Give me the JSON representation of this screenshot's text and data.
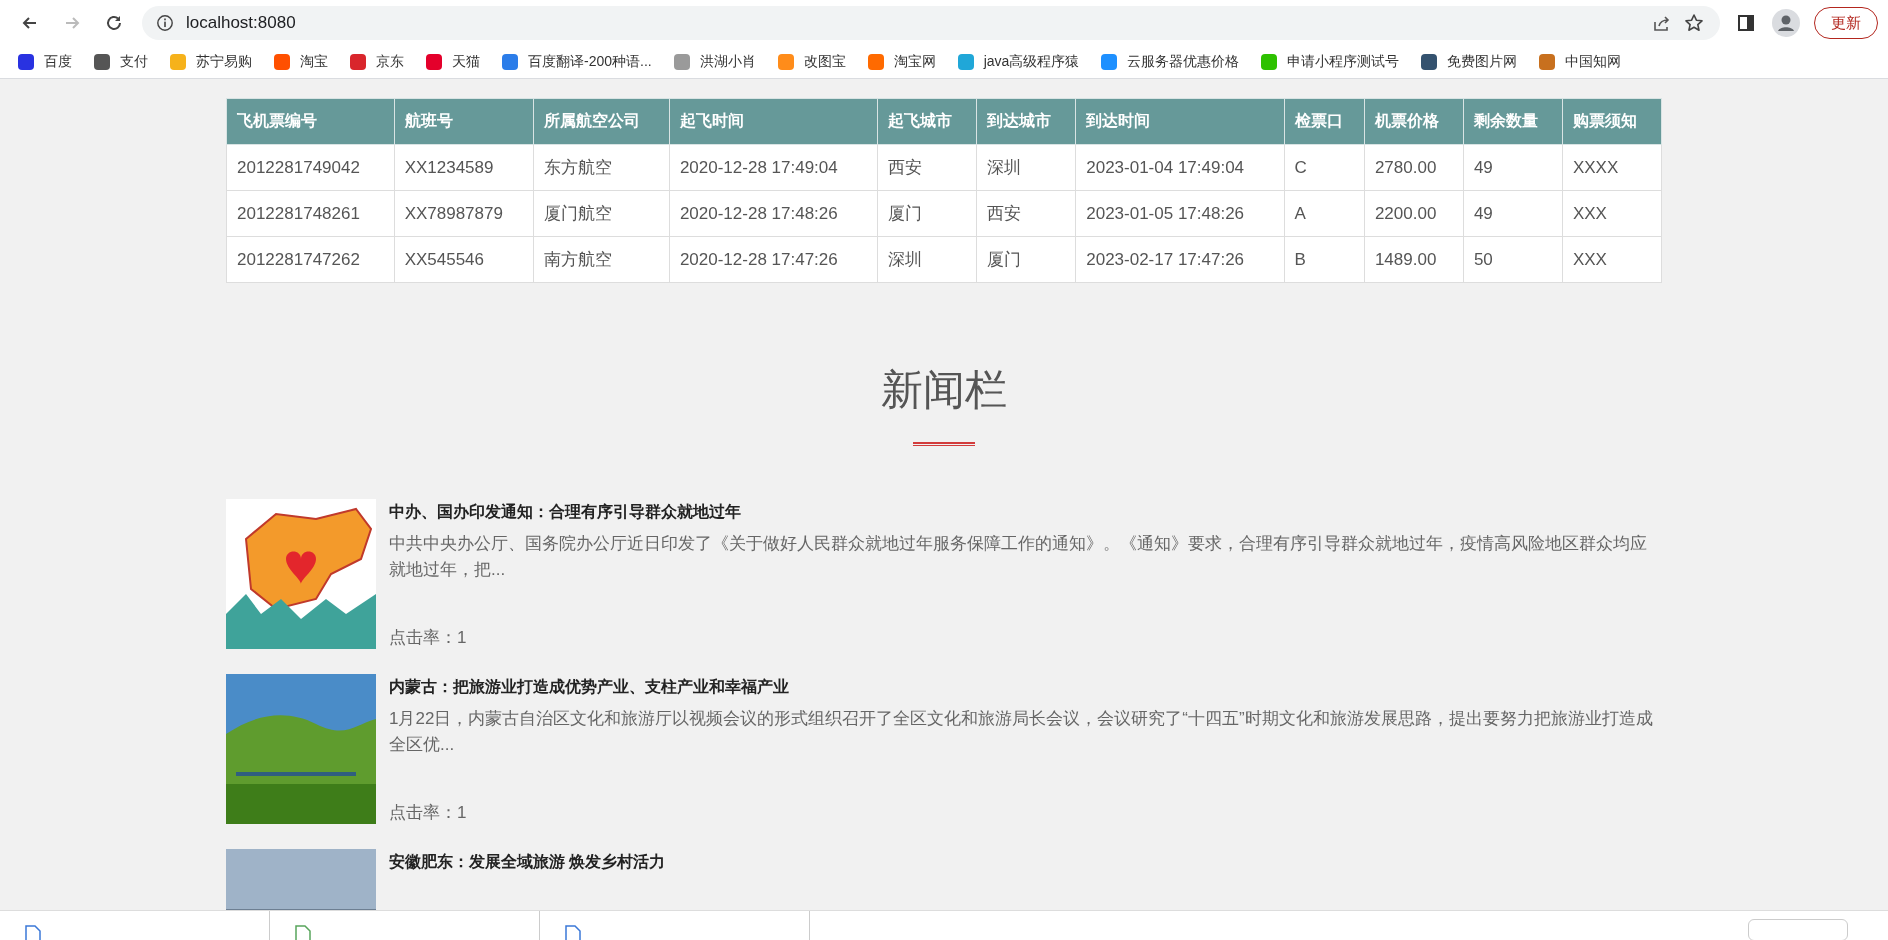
{
  "browser": {
    "back_disabled": false,
    "forward_disabled": true,
    "url": "localhost:8080",
    "update_button": "更新"
  },
  "bookmarks": [
    {
      "label": "百度",
      "color": "#2932e1"
    },
    {
      "label": "支付",
      "color": "#555555"
    },
    {
      "label": "苏宁易购",
      "color": "#f6b21b"
    },
    {
      "label": "淘宝",
      "color": "#ff5000"
    },
    {
      "label": "京东",
      "color": "#d9262c"
    },
    {
      "label": "天猫",
      "color": "#e4002b"
    },
    {
      "label": "百度翻译-200种语...",
      "color": "#2b7de9"
    },
    {
      "label": "洪湖小肖",
      "color": "#9a9a9a"
    },
    {
      "label": "改图宝",
      "color": "#ff8c1a"
    },
    {
      "label": "淘宝网",
      "color": "#ff6a00"
    },
    {
      "label": "java高级程序猿",
      "color": "#20a7d8"
    },
    {
      "label": "云服务器优惠价格",
      "color": "#1e90ff"
    },
    {
      "label": "申请小程序测试号",
      "color": "#2dc100"
    },
    {
      "label": "免费图片网",
      "color": "#34526f"
    },
    {
      "label": "中国知网",
      "color": "#c8701e"
    }
  ],
  "table": {
    "columns": [
      "飞机票编号",
      "航班号",
      "所属航空公司",
      "起飞时间",
      "起飞城市",
      "到达城市",
      "到达时间",
      "检票口",
      "机票价格",
      "剩余数量",
      "购票须知"
    ],
    "rows": [
      [
        "2012281749042",
        "XX1234589",
        "东方航空",
        "2020-12-28 17:49:04",
        "西安",
        "深圳",
        "2023-01-04 17:49:04",
        "C",
        "2780.00",
        "49",
        "XXXX"
      ],
      [
        "2012281748261",
        "XX78987879",
        "厦门航空",
        "2020-12-28 17:48:26",
        "厦门",
        "西安",
        "2023-01-05 17:48:26",
        "A",
        "2200.00",
        "49",
        "XXX"
      ],
      [
        "2012281747262",
        "XX545546",
        "南方航空",
        "2020-12-28 17:47:26",
        "深圳",
        "厦门",
        "2023-02-17 17:47:26",
        "B",
        "1489.00",
        "50",
        "XXX"
      ]
    ]
  },
  "news": {
    "heading": "新闻栏",
    "items": [
      {
        "kind": "map",
        "title": "中办、国办印发通知：合理有序引导群众就地过年",
        "summary": "中共中央办公厅、国务院办公厅近日印发了《关于做好人民群众就地过年服务保障工作的通知》。《通知》要求，合理有序引导群众就地过年，疫情高风险地区群众均应就地过年，把...",
        "clicks": "点击率：1"
      },
      {
        "kind": "grassland",
        "title": "内蒙古：把旅游业打造成优势产业、支柱产业和幸福产业",
        "summary": "1月22日，内蒙古自治区文化和旅游厅以视频会议的形式组织召开了全区文化和旅游局长会议，会议研究了“十四五”时期文化和旅游发展思路，提出要努力把旅游业打造成全区优...",
        "clicks": "点击率：1"
      },
      {
        "kind": "sky",
        "title": "安徽肥东：发展全域旅游 焕发乡村活力"
      }
    ]
  },
  "downloads": {
    "items": [
      {
        "kind": "file"
      },
      {
        "kind": "image"
      },
      {
        "kind": "file"
      }
    ]
  }
}
